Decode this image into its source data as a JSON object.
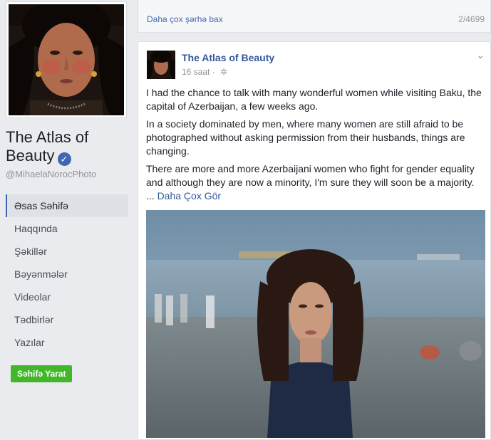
{
  "sidebar": {
    "page_name": "The Atlas of Beauty",
    "handle": "@MihaelaNorocPhoto",
    "nav_items": [
      "Əsas Səhifə",
      "Haqqında",
      "Şəkillər",
      "Bəyənmələr",
      "Videolar",
      "Tədbirlər",
      "Yazılar"
    ],
    "create_page_label": "Səhifə Yarat",
    "accent_color": "#4267b2",
    "create_button_color": "#42b72a"
  },
  "comments_bar": {
    "more_comments_label": "Daha çox şərhə bax",
    "count": "2/4699"
  },
  "post": {
    "author": "The Atlas of Beauty",
    "time": "16 saat",
    "privacy_icon": "gear-icon",
    "paragraphs": [
      "I had the chance to talk with many wonderful women while visiting Baku, the capital of Azerbaijan, a few weeks ago.",
      "In a society dominated by men, where many women are still afraid to be photographed without asking permission from their husbands, things are changing.",
      "There are more and more Azerbaijani women who fight for gender equality and although they are now a minority, I'm sure they will soon be a majority."
    ],
    "see_more_prefix": "...",
    "see_more_label": "Daha Çox Gör"
  }
}
